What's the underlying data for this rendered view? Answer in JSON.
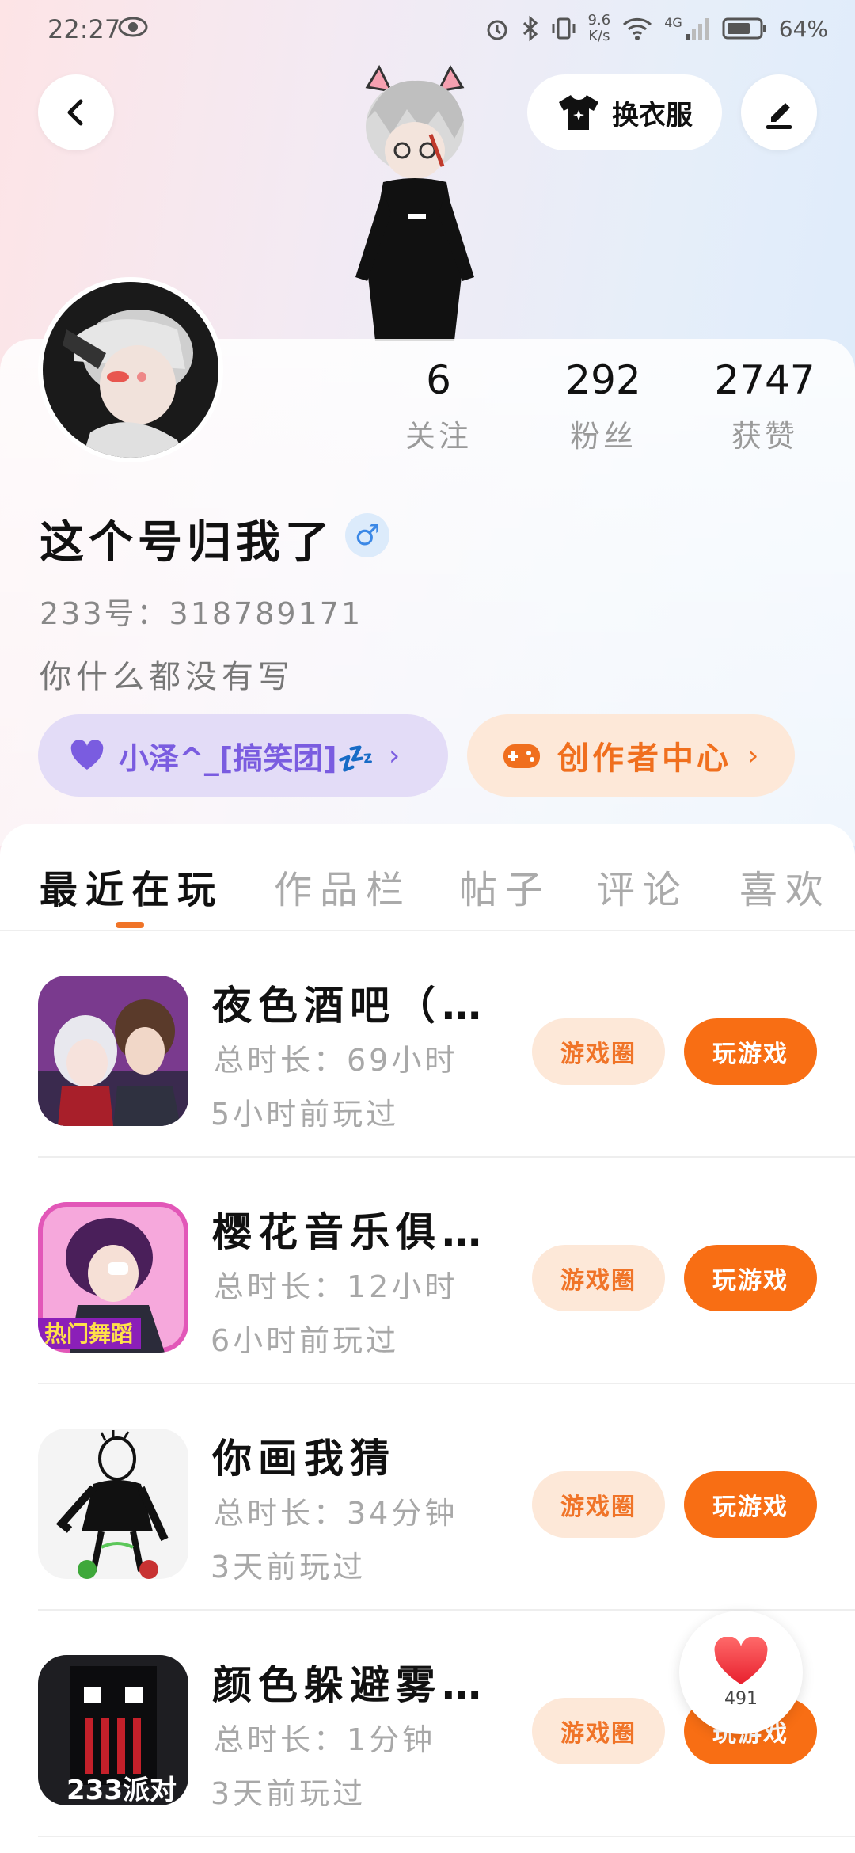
{
  "status_bar": {
    "time": "22:27",
    "net_speed_top": "9.6",
    "net_speed_bottom": "K/s",
    "network": "4G",
    "battery": "64%"
  },
  "header": {
    "outfit_label": "换衣服"
  },
  "profile": {
    "stats": [
      {
        "value": "6",
        "label": "关注"
      },
      {
        "value": "292",
        "label": "粉丝"
      },
      {
        "value": "2747",
        "label": "获赞"
      }
    ],
    "username": "这个号归我了",
    "gender_symbol": "♂",
    "uid": "233号：318789171",
    "bio": "你什么都没有写",
    "group_pill": "小泽^_[搞笑团]💤",
    "creator_pill": "创作者中心"
  },
  "tabs": [
    {
      "label": "最近在玩"
    },
    {
      "label": "作品栏"
    },
    {
      "label": "帖子"
    },
    {
      "label": "评论"
    },
    {
      "label": "喜欢"
    }
  ],
  "games": [
    {
      "name": "夜色酒吧（…",
      "total": "总时长：69小时",
      "last": "5小时前玩过",
      "btn_circle": "游戏圈",
      "btn_play": "玩游戏"
    },
    {
      "name": "樱花音乐俱…",
      "total": "总时长：12小时",
      "last": "6小时前玩过",
      "btn_circle": "游戏圈",
      "btn_play": "玩游戏"
    },
    {
      "name": "你画我猜",
      "total": "总时长：34分钟",
      "last": "3天前玩过",
      "btn_circle": "游戏圈",
      "btn_play": "玩游戏"
    },
    {
      "name": "颜色躲避雾…",
      "total": "总时长：1分钟",
      "last": "3天前玩过",
      "btn_circle": "游戏圈",
      "btn_play": "玩游戏"
    }
  ],
  "game_icon_texts": {
    "game2_banner": "热门舞蹈",
    "game4_banner": "233派对"
  },
  "float_like": {
    "count": "491"
  },
  "colors": {
    "accent_orange": "#f86e14",
    "accent_purple": "#7a5ce0"
  }
}
